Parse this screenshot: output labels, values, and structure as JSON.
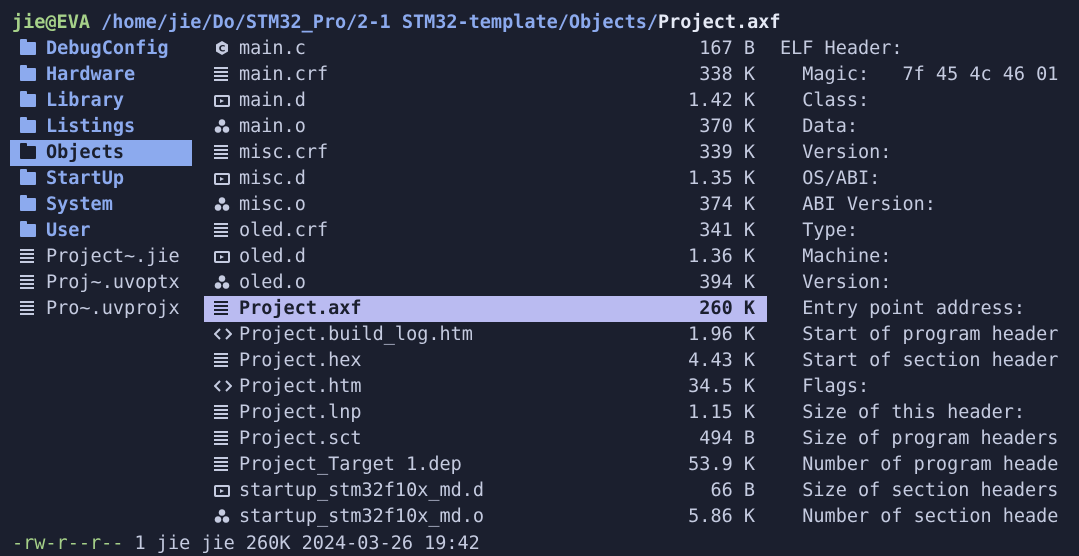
{
  "title": {
    "user_host": "jie@EVA",
    "path": " /home/jie/Do/STM32_Pro/2-1 STM32-template/Objects/",
    "current_file": "Project.axf"
  },
  "parent": [
    {
      "name": "DebugConfig",
      "type": "dir",
      "icon": "folder-icon"
    },
    {
      "name": "Hardware",
      "type": "dir",
      "icon": "folder-icon"
    },
    {
      "name": "Library",
      "type": "dir",
      "icon": "folder-icon"
    },
    {
      "name": "Listings",
      "type": "dir",
      "icon": "folder-icon"
    },
    {
      "name": "Objects",
      "type": "dir",
      "icon": "folder-icon",
      "selected": true
    },
    {
      "name": "StartUp",
      "type": "dir",
      "icon": "folder-icon"
    },
    {
      "name": "System",
      "type": "dir",
      "icon": "folder-icon"
    },
    {
      "name": "User",
      "type": "dir",
      "icon": "folder-icon"
    },
    {
      "name": "Project~.jie",
      "type": "file",
      "icon": "text-file-icon"
    },
    {
      "name": "Proj~.uvoptx",
      "type": "file",
      "icon": "text-file-icon"
    },
    {
      "name": "Pro~.uvprojx",
      "type": "file",
      "icon": "text-file-icon"
    }
  ],
  "files": [
    {
      "name": "main.c",
      "size": "167 B",
      "icon": "c-source-icon"
    },
    {
      "name": "main.crf",
      "size": "338 K",
      "icon": "text-file-icon"
    },
    {
      "name": "main.d",
      "size": "1.42 K",
      "icon": "dep-file-icon"
    },
    {
      "name": "main.o",
      "size": "370 K",
      "icon": "object-file-icon"
    },
    {
      "name": "misc.crf",
      "size": "339 K",
      "icon": "text-file-icon"
    },
    {
      "name": "misc.d",
      "size": "1.35 K",
      "icon": "dep-file-icon"
    },
    {
      "name": "misc.o",
      "size": "374 K",
      "icon": "object-file-icon"
    },
    {
      "name": "oled.crf",
      "size": "341 K",
      "icon": "text-file-icon"
    },
    {
      "name": "oled.d",
      "size": "1.36 K",
      "icon": "dep-file-icon"
    },
    {
      "name": "oled.o",
      "size": "394 K",
      "icon": "object-file-icon"
    },
    {
      "name": "Project.axf",
      "size": "260 K",
      "icon": "text-file-icon",
      "selected": true
    },
    {
      "name": "Project.build_log.htm",
      "size": "1.96 K",
      "icon": "code-icon"
    },
    {
      "name": "Project.hex",
      "size": "4.43 K",
      "icon": "text-file-icon"
    },
    {
      "name": "Project.htm",
      "size": "34.5 K",
      "icon": "code-icon"
    },
    {
      "name": "Project.lnp",
      "size": "1.15 K",
      "icon": "text-file-icon"
    },
    {
      "name": "Project.sct",
      "size": "494 B",
      "icon": "text-file-icon"
    },
    {
      "name": "Project_Target 1.dep",
      "size": "53.9 K",
      "icon": "text-file-icon"
    },
    {
      "name": "startup_stm32f10x_md.d",
      "size": "66 B",
      "icon": "dep-file-icon"
    },
    {
      "name": "startup_stm32f10x_md.o",
      "size": "5.86 K",
      "icon": "object-file-icon"
    }
  ],
  "preview": [
    "ELF Header:",
    "  Magic:   7f 45 4c 46 01",
    "  Class:",
    "  Data:",
    "  Version:",
    "  OS/ABI:",
    "  ABI Version:",
    "  Type:",
    "  Machine:",
    "  Version:",
    "  Entry point address:",
    "  Start of program header",
    "  Start of section header",
    "  Flags:",
    "  Size of this header:",
    "  Size of program headers",
    "  Number of program heade",
    "  Size of section headers",
    "  Number of section heade"
  ],
  "status": {
    "permissions": "-rw-r--r--",
    "info": " 1 jie jie 260K 2024-03-26 19:42"
  },
  "colors": {
    "background": "#1b1f2e",
    "directory": "#8caaee",
    "selection": "#babbf1",
    "user": "#a6d189"
  }
}
